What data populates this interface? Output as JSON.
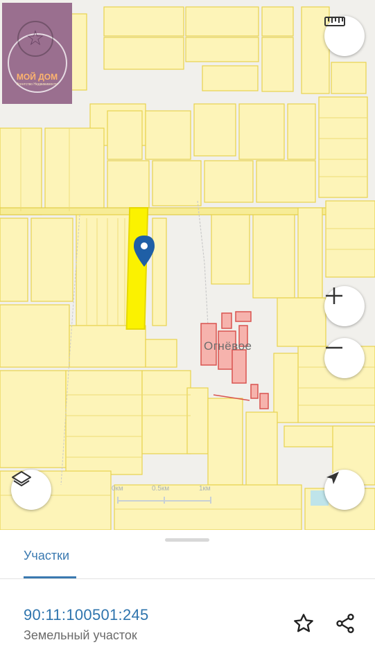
{
  "map": {
    "town_label": "Огнёвое",
    "scale_labels": [
      "0км",
      "0.5км",
      "1км"
    ],
    "colors": {
      "parcel_fill": "#fdf4b8",
      "parcel_border": "#e8d34e",
      "selected_parcel": "#fbf200",
      "marker": "#1f5fa6",
      "settlement": "#d9534f"
    },
    "controls": {
      "ruler": "ruler-icon",
      "zoom_in": "plus-icon",
      "zoom_out": "minus-icon",
      "layers": "layers-icon",
      "locate": "navigation-arrow-icon"
    }
  },
  "logo": {
    "title": "МОЙ ДОМ",
    "subtitle": "Агентство Недвижимости"
  },
  "sheet": {
    "tabs": [
      {
        "label": "Участки",
        "active": true
      }
    ],
    "parcel": {
      "cadastral_number": "90:11:100501:245",
      "type": "Земельный участок"
    }
  }
}
